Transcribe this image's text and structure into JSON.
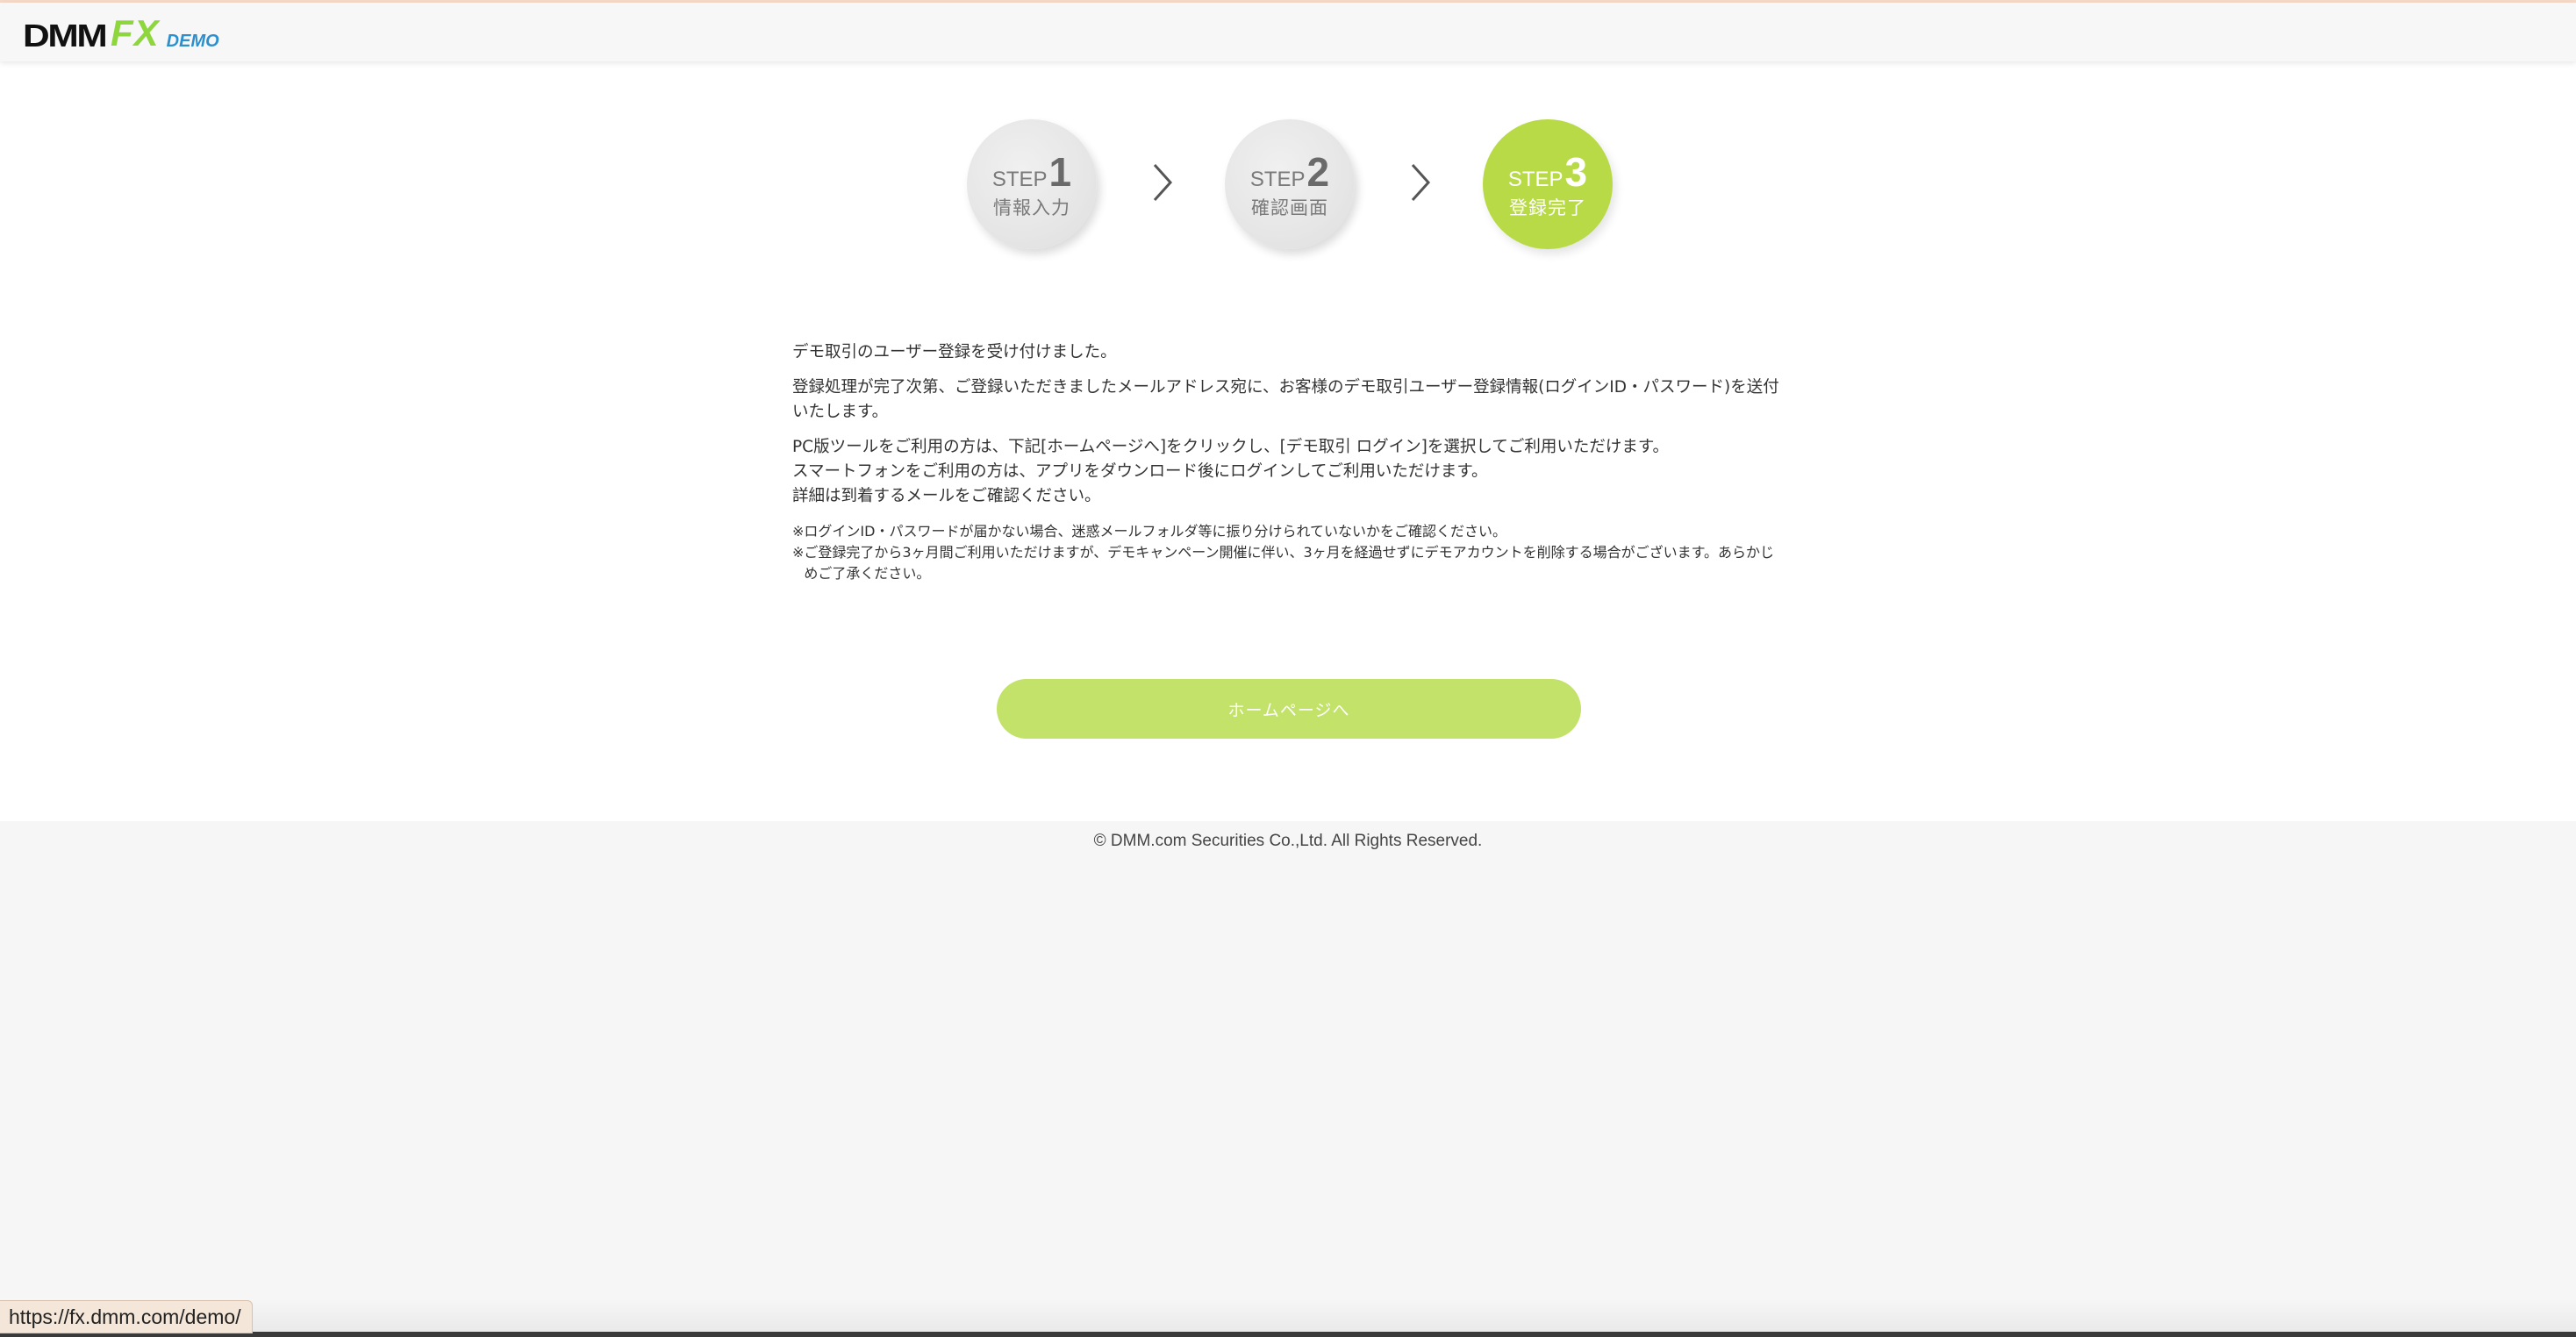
{
  "header": {
    "logo_dmm": "DMM",
    "logo_fx": "FX",
    "logo_demo": "DEMO"
  },
  "steps": [
    {
      "word": "STEP",
      "number": "1",
      "label": "情報入力",
      "active": false
    },
    {
      "word": "STEP",
      "number": "2",
      "label": "確認画面",
      "active": false
    },
    {
      "word": "STEP",
      "number": "3",
      "label": "登録完了",
      "active": true
    }
  ],
  "message": {
    "p1": "デモ取引のユーザー登録を受け付けました。",
    "p2": "登録処理が完了次第、ご登録いただきましたメールアドレス宛に、お客様のデモ取引ユーザー登録情報(ログインID・パスワード)を送付いたします。",
    "p3_line1": "PC版ツールをご利用の方は、下記[ホームページへ]をクリックし、[デモ取引 ログイン]を選択してご利用いただけます。",
    "p3_line2": "スマートフォンをご利用の方は、アプリをダウンロード後にログインしてご利用いただけます。",
    "p3_line3": "詳細は到着するメールをご確認ください。",
    "note_mark": "※",
    "note1": "ログインID・パスワードが届かない場合、迷惑メールフォルダ等に振り分けられていないかをご確認ください。",
    "note2": "ご登録完了から3ヶ月間ご利用いただけますが、デモキャンペーン開催に伴い、3ヶ月を経過せずにデモアカウントを削除する場合がございます。あらかじめご了承ください。"
  },
  "cta": {
    "label": "ホームページへ"
  },
  "footer": {
    "copyright": "© DMM.com Securities Co.,Ltd. All Rights Reserved."
  },
  "status_bar": {
    "url": "https://fx.dmm.com/demo/"
  },
  "colors": {
    "accent_green": "#b8da46",
    "button_green": "#c3e269",
    "logo_fx_green": "#8ed63d",
    "logo_demo_blue": "#2e8fcd"
  }
}
